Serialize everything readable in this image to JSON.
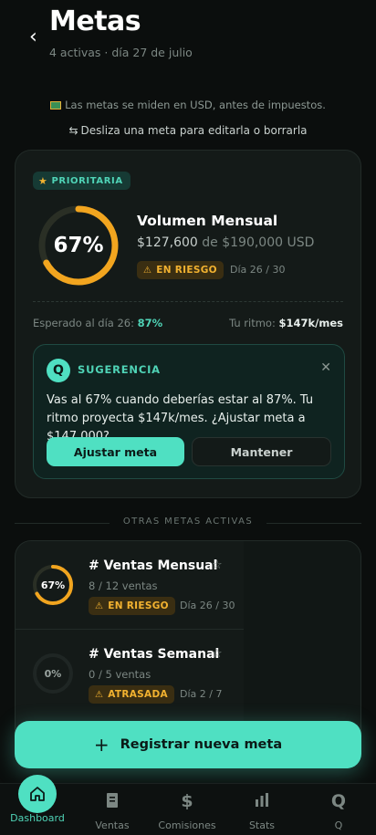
{
  "header": {
    "title": "Metas",
    "subtitle": "4 activas · día 27 de julio"
  },
  "notices": {
    "currency": "Las metas se miden en USD, antes de impuestos.",
    "swipe": "Desliza una meta para editarla o borrarla"
  },
  "main_goal": {
    "badge": "PRIORITARIA",
    "percent_label": "67%",
    "progress": 0.67,
    "name": "Volumen Mensual",
    "current": "$127,600",
    "of_label": "de",
    "target": "$190,000 USD",
    "status": "EN RIESGO",
    "day": "Día 26 / 30",
    "expected_label": "Esperado al día 26:",
    "expected_value": "87%",
    "rhythm_label": "Tu ritmo:",
    "rhythm_value": "$147k/mes"
  },
  "suggestion": {
    "title": "SUGERENCIA",
    "text": "Vas al 67% cuando deberías estar al 87%. Tu ritmo proyecta $147k/mes. ¿Ajustar meta a $147,000?",
    "primary": "Ajustar meta",
    "secondary": "Mantener"
  },
  "other_goals": {
    "heading": "OTRAS METAS ACTIVAS",
    "items": [
      {
        "name": "# Ventas Mensual",
        "percent_label": "67%",
        "progress": 0.67,
        "count": "8 / 12 ventas",
        "status": "EN RIESGO",
        "day": "Día 26 / 30"
      },
      {
        "name": "# Ventas Semanal",
        "percent_label": "0%",
        "progress": 0,
        "count": "0 / 5 ventas",
        "status": "ATRASADA",
        "day": "Día 2 / 7"
      }
    ]
  },
  "fab": {
    "label": "Registrar nueva meta"
  },
  "tabs": [
    {
      "label": "Dashboard",
      "icon": "home-icon",
      "active": true
    },
    {
      "label": "Ventas",
      "icon": "receipt-icon"
    },
    {
      "label": "Comisiones",
      "icon": "dollar-icon"
    },
    {
      "label": "Stats",
      "icon": "bar-chart-icon"
    },
    {
      "label": "Q",
      "icon": "q-logo-icon"
    }
  ],
  "colors": {
    "accent": "#4fe0c2",
    "warning": "#f2b230",
    "background": "#0b0e0d"
  }
}
